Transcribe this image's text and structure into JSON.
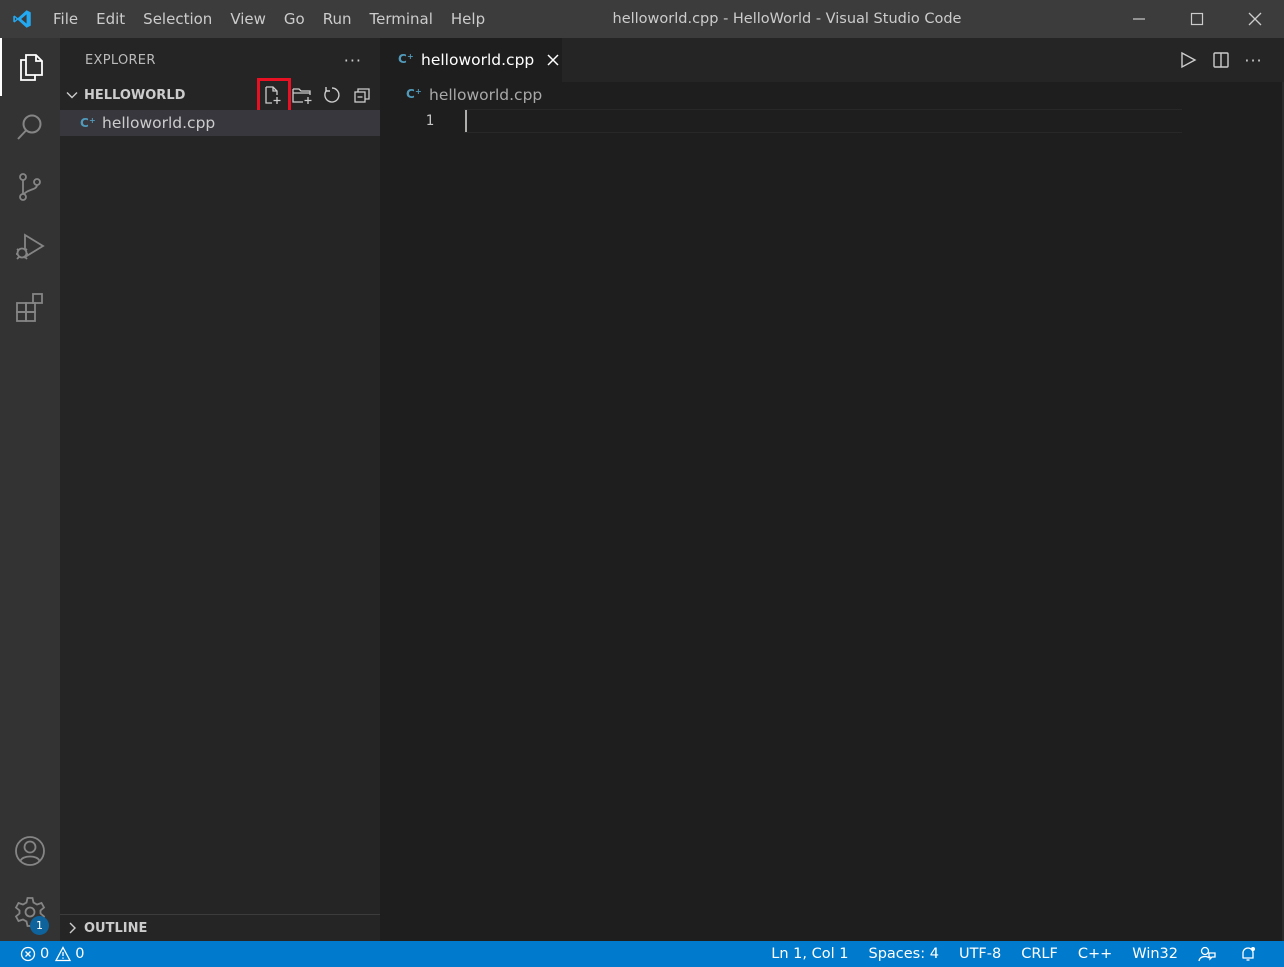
{
  "window": {
    "title": "helloworld.cpp - HelloWorld - Visual Studio Code"
  },
  "menu": {
    "items": [
      "File",
      "Edit",
      "Selection",
      "View",
      "Go",
      "Run",
      "Terminal",
      "Help"
    ]
  },
  "activity_bar": {
    "items": [
      "explorer-icon",
      "search-icon",
      "source-control-icon",
      "run-debug-icon",
      "extensions-icon"
    ],
    "bottom": [
      "account-icon",
      "manage-gear-icon"
    ],
    "manage_badge": "1"
  },
  "sidebar": {
    "title": "EXPLORER",
    "more": "···",
    "folder": {
      "name": "HELLOWORLD",
      "actions": [
        "new-file-icon",
        "new-folder-icon",
        "refresh-icon",
        "collapse-all-icon"
      ],
      "files": [
        {
          "name": "helloworld.cpp",
          "icon": "cpp-file-icon"
        }
      ]
    },
    "outline": "OUTLINE"
  },
  "editor": {
    "tab": {
      "label": "helloworld.cpp",
      "icon": "cpp-file-icon"
    },
    "actions": [
      "run-icon",
      "split-editor-icon",
      "more-actions-icon"
    ],
    "more": "···",
    "breadcrumb": "helloworld.cpp",
    "lines": [
      "1"
    ]
  },
  "status_bar": {
    "errors": "0",
    "warnings": "0",
    "position": "Ln 1, Col 1",
    "spaces": "Spaces: 4",
    "encoding": "UTF-8",
    "eol": "CRLF",
    "language": "C++",
    "platform": "Win32"
  },
  "colors": {
    "accent": "#007acc",
    "highlight_box": "#e81123",
    "cpp_icon": "#519aba"
  }
}
